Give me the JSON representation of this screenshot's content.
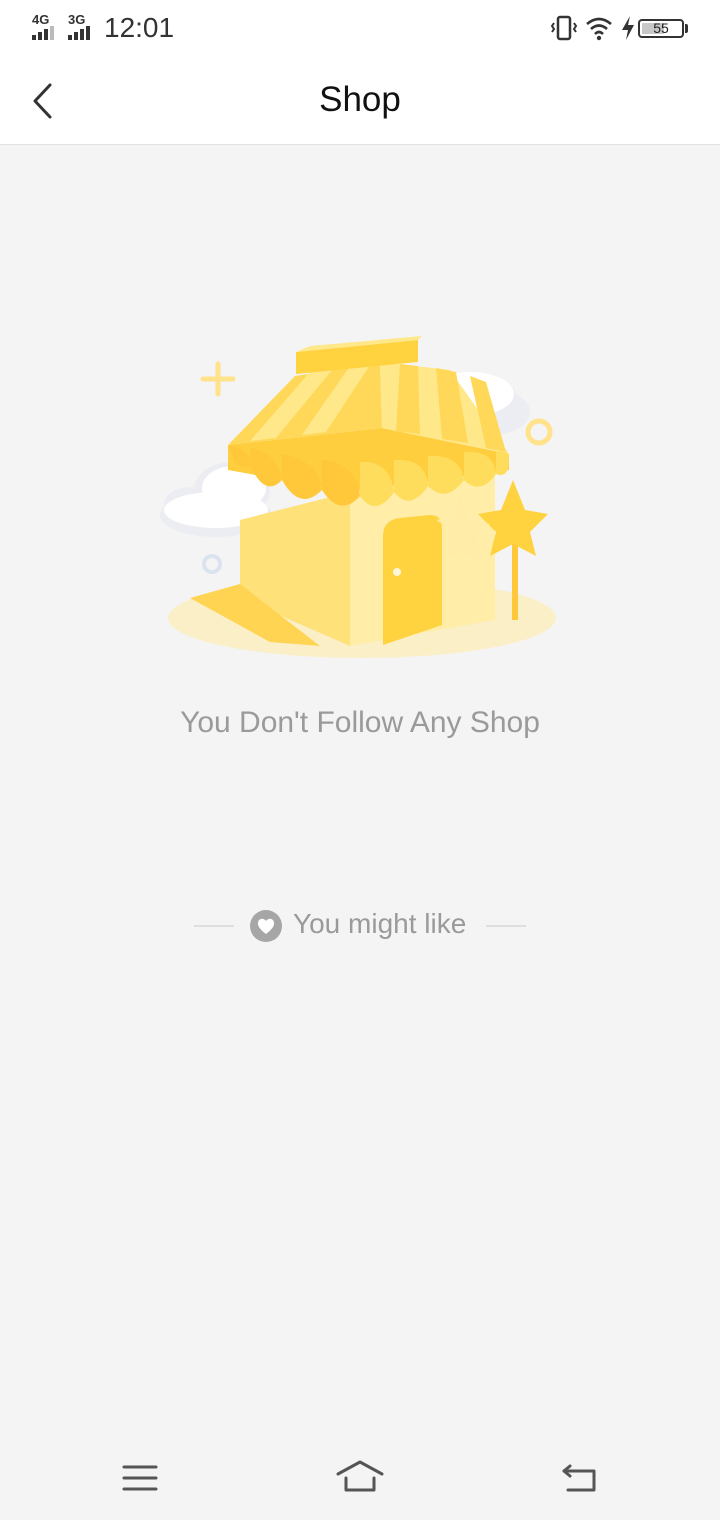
{
  "status_bar": {
    "network_1": "4G",
    "network_2": "3G",
    "time": "12:01",
    "battery_level": "55",
    "icons": [
      "vibrate-icon",
      "wifi-icon",
      "charging-icon",
      "battery-icon"
    ]
  },
  "header": {
    "title": "Shop",
    "back_icon": "chevron-left-icon"
  },
  "empty_state": {
    "illustration": "shop-illustration",
    "message": "You Don't Follow Any Shop"
  },
  "recommendations": {
    "label": "You might like",
    "icon": "heart-icon"
  },
  "system_nav": {
    "icons": [
      "menu-icon",
      "home-icon",
      "back-icon"
    ]
  },
  "colors": {
    "accent_yellow": "#FFD23F",
    "light_yellow": "#FFE98A",
    "text_gray": "#9A9A9A",
    "background": "#F4F4F4"
  }
}
